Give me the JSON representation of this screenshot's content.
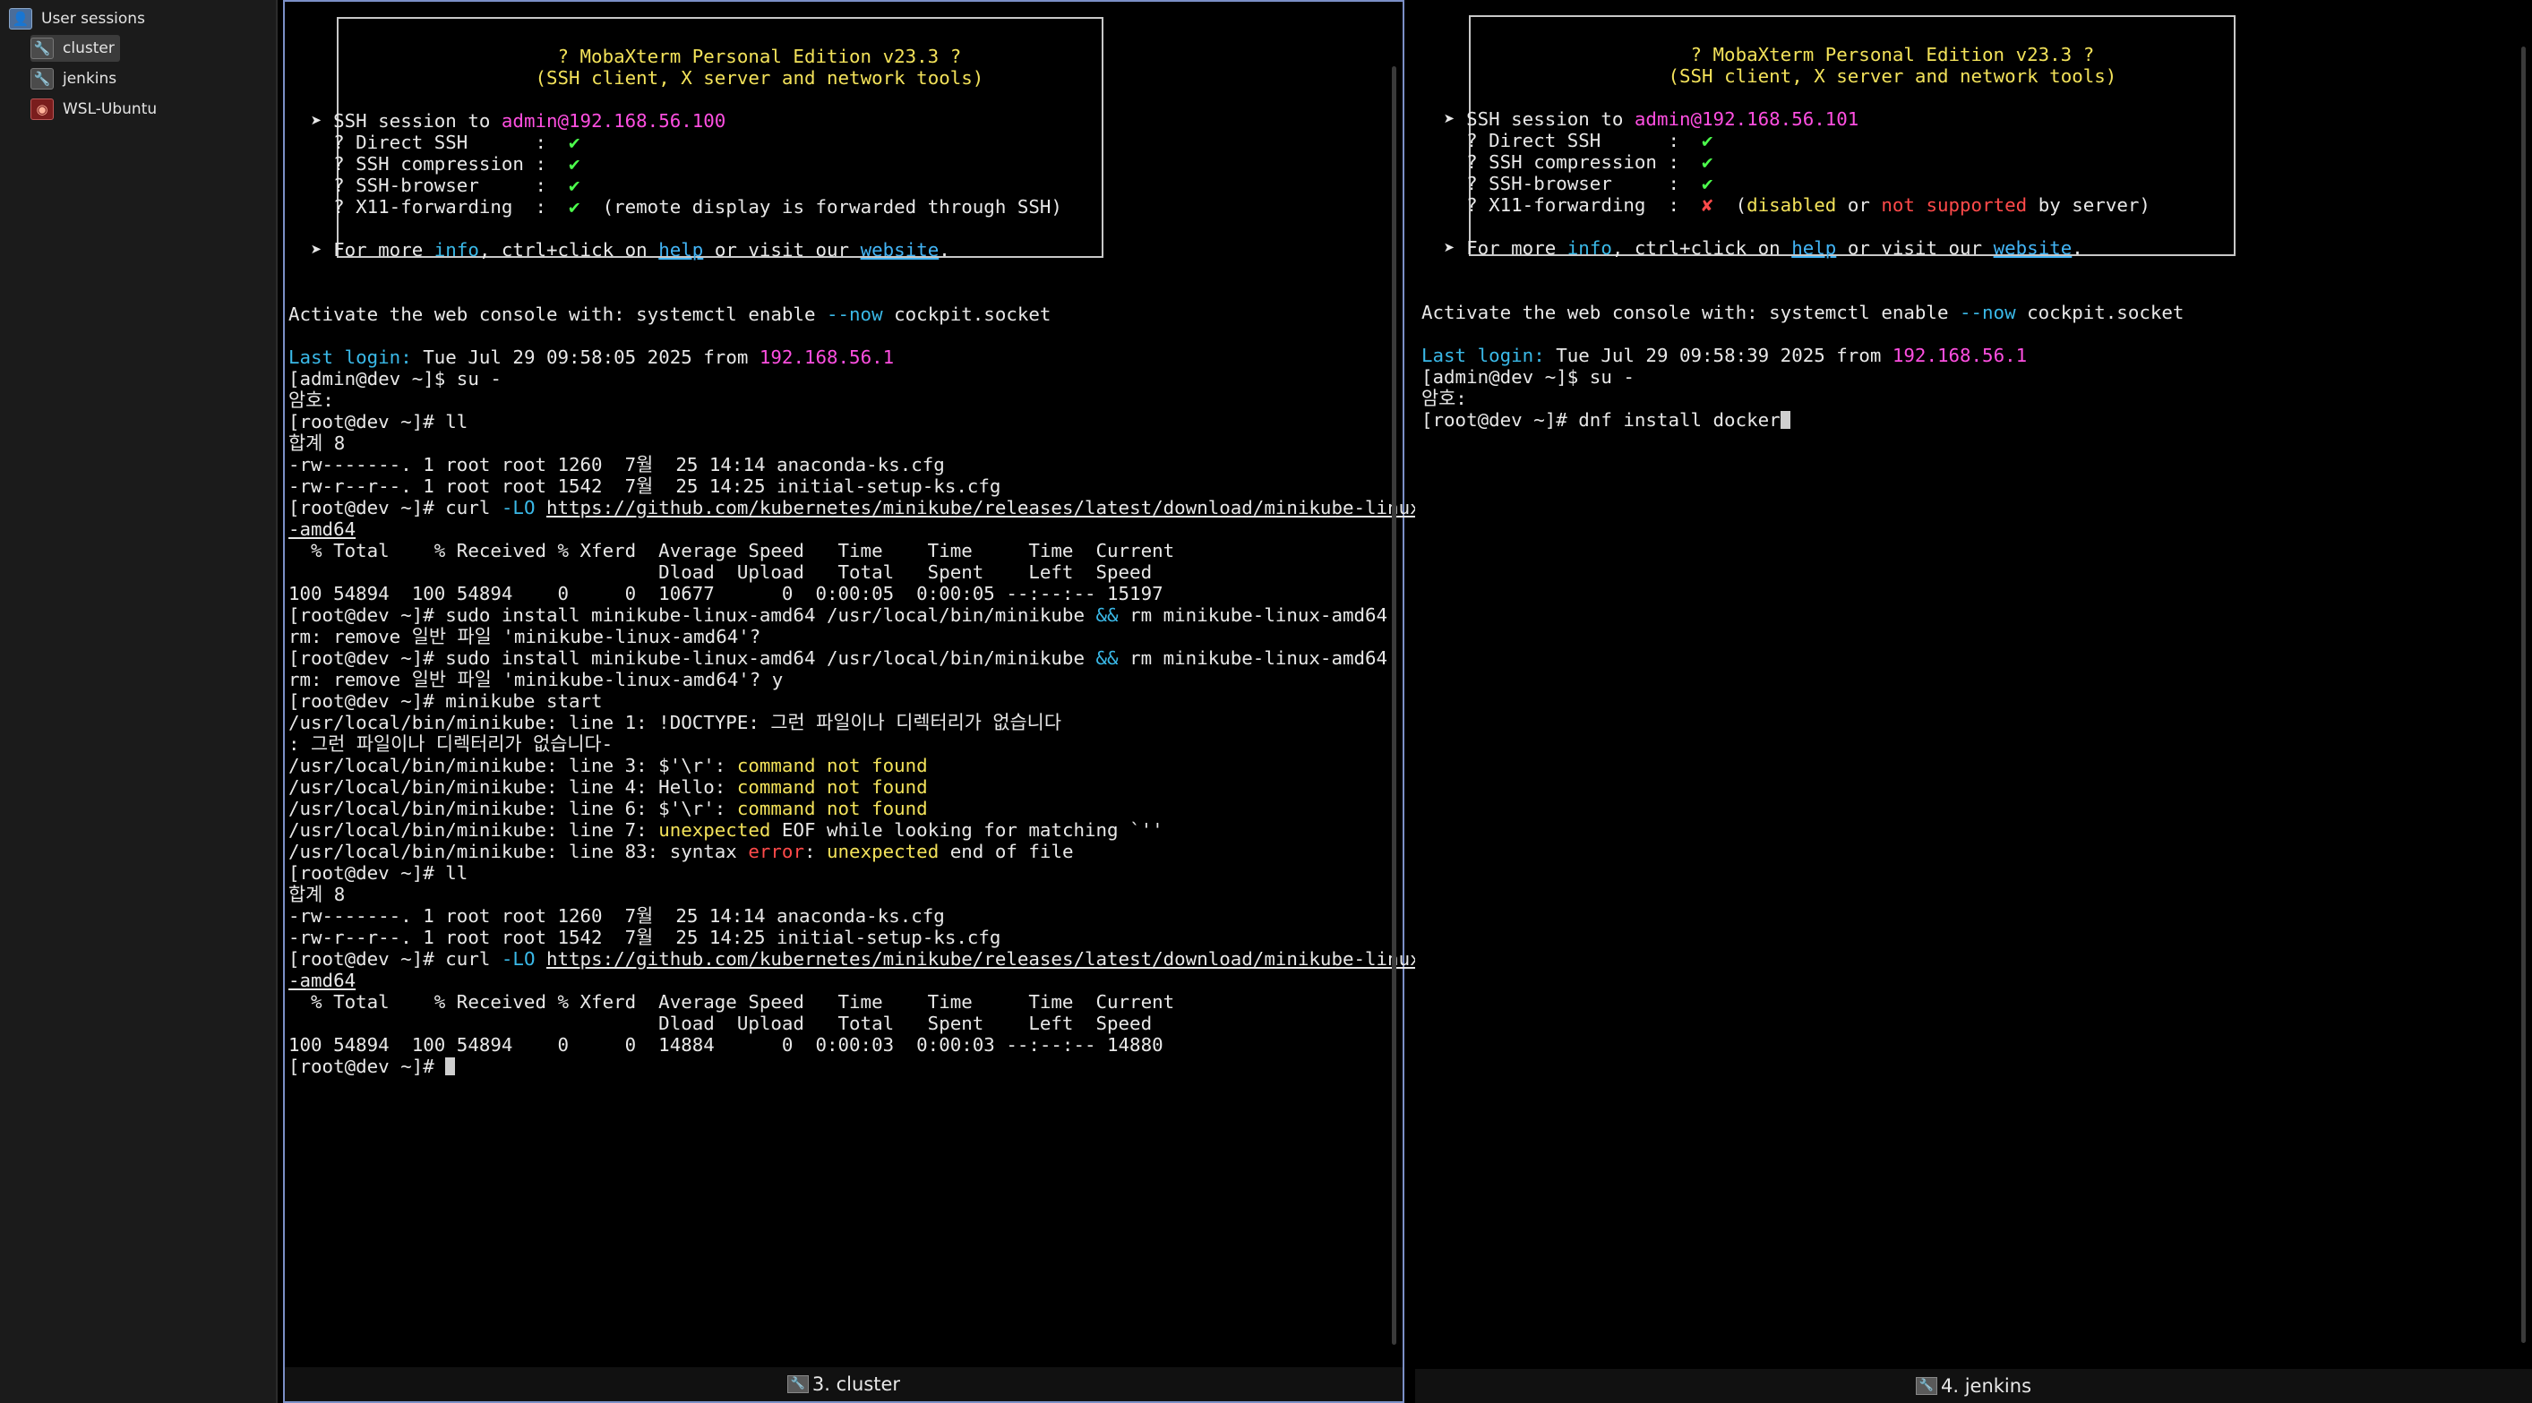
{
  "sidebar": {
    "header_label": "User sessions",
    "items": [
      {
        "label": "cluster",
        "icon": "wrench-icon",
        "active": true
      },
      {
        "label": "jenkins",
        "icon": "wrench-icon",
        "active": false
      },
      {
        "label": "WSL-Ubuntu",
        "icon": "ubuntu-icon",
        "active": false
      }
    ]
  },
  "banner": {
    "title": "? MobaXterm Personal Edition v23.3 ?",
    "subtitle": "(SSH client, X server and network tools)"
  },
  "tabs": {
    "left": "3. cluster",
    "right": "4. jenkins"
  },
  "colors": {
    "pane_border_active": "#7b8fc6",
    "green": "#3ce27a",
    "magenta": "#ff4fe1",
    "cyan": "#3ab9e8",
    "yellow": "#f3e25a",
    "red": "#ff4a4a"
  },
  "left_terminal": [
    [
      [
        "b",
        " "
      ]
    ],
    [
      [
        "t",
        "                        "
      ],
      [
        "y",
        "? MobaXterm Personal Edition v23.3 ?"
      ]
    ],
    [
      [
        "t",
        "                      "
      ],
      [
        "y",
        "(SSH client, X server and network tools)"
      ]
    ],
    [
      [
        "b",
        " "
      ]
    ],
    [
      [
        "t",
        "  ➤ SSH session to "
      ],
      [
        "m",
        "admin@192.168.56.100"
      ]
    ],
    [
      [
        "t",
        "    ? Direct SSH      :  "
      ],
      [
        "g",
        "✔"
      ]
    ],
    [
      [
        "t",
        "    ? SSH compression :  "
      ],
      [
        "g",
        "✔"
      ]
    ],
    [
      [
        "t",
        "    ? SSH-browser     :  "
      ],
      [
        "g",
        "✔"
      ]
    ],
    [
      [
        "t",
        "    ? X11-forwarding  :  "
      ],
      [
        "g",
        "✔"
      ],
      [
        "t",
        "  (remote display is forwarded through SSH)"
      ]
    ],
    [
      [
        "b",
        " "
      ]
    ],
    [
      [
        "t",
        "  ➤ For more "
      ],
      [
        "c",
        "info"
      ],
      [
        "t",
        ", ctrl+click on "
      ],
      [
        "l",
        "help"
      ],
      [
        "t",
        " or visit our "
      ],
      [
        "l",
        "website"
      ],
      [
        "t",
        "."
      ]
    ],
    [
      [
        "b",
        " "
      ]
    ],
    [
      [
        "b",
        " "
      ]
    ],
    [
      [
        "t",
        "Activate the web console with: systemctl enable "
      ],
      [
        "c",
        "--now"
      ],
      [
        "t",
        " cockpit.socket"
      ]
    ],
    [
      [
        "b",
        " "
      ]
    ],
    [
      [
        "c",
        "Last login:"
      ],
      [
        "t",
        " Tue Jul 29 09:58:05 2025 from "
      ],
      [
        "m",
        "192.168.56.1"
      ]
    ],
    [
      [
        "t",
        "[admin@dev ~]$ su -"
      ]
    ],
    [
      [
        "t",
        "암호:"
      ]
    ],
    [
      [
        "t",
        "[root@dev ~]# ll"
      ]
    ],
    [
      [
        "t",
        "합계 8"
      ]
    ],
    [
      [
        "t",
        "-rw-------. 1 root root 1260  7월  25 14:14 anaconda-ks.cfg"
      ]
    ],
    [
      [
        "t",
        "-rw-r--r--. 1 root root 1542  7월  25 14:25 initial-setup-ks.cfg"
      ]
    ],
    [
      [
        "t",
        "[root@dev ~]# curl "
      ],
      [
        "c",
        "-LO"
      ],
      [
        "t",
        " "
      ],
      [
        "u",
        "https://github.com/kubernetes/minikube/releases/latest/download/minikube-linux"
      ]
    ],
    [
      [
        "u",
        "-amd64"
      ]
    ],
    [
      [
        "t",
        "  % Total    % Received % Xferd  Average Speed   Time    Time     Time  Current"
      ]
    ],
    [
      [
        "t",
        "                                 Dload  Upload   Total   Spent    Left  Speed"
      ]
    ],
    [
      [
        "t",
        "100 54894  100 54894    0     0  10677      0  0:00:05  0:00:05 --:--:-- 15197"
      ]
    ],
    [
      [
        "t",
        "[root@dev ~]# sudo install minikube-linux-amd64 /usr/local/bin/minikube "
      ],
      [
        "c",
        "&&"
      ],
      [
        "t",
        " rm minikube-linux-amd64"
      ]
    ],
    [
      [
        "t",
        "rm: remove 일반 파일 'minikube-linux-amd64'?"
      ]
    ],
    [
      [
        "t",
        "[root@dev ~]# sudo install minikube-linux-amd64 /usr/local/bin/minikube "
      ],
      [
        "c",
        "&&"
      ],
      [
        "t",
        " rm minikube-linux-amd64"
      ]
    ],
    [
      [
        "t",
        "rm: remove 일반 파일 'minikube-linux-amd64'? y"
      ]
    ],
    [
      [
        "t",
        "[root@dev ~]# minikube start"
      ]
    ],
    [
      [
        "t",
        "/usr/local/bin/minikube: line 1: !DOCTYPE: 그런 파일이나 디렉터리가 없습니다"
      ]
    ],
    [
      [
        "t",
        ": 그런 파일이나 디렉터리가 없습니다-"
      ]
    ],
    [
      [
        "t",
        "/usr/local/bin/minikube: line 3: $'\\r': "
      ],
      [
        "y",
        "command not found"
      ]
    ],
    [
      [
        "t",
        "/usr/local/bin/minikube: line 4: Hello: "
      ],
      [
        "y",
        "command not found"
      ]
    ],
    [
      [
        "t",
        "/usr/local/bin/minikube: line 6: $'\\r': "
      ],
      [
        "y",
        "command not found"
      ]
    ],
    [
      [
        "t",
        "/usr/local/bin/minikube: line 7: "
      ],
      [
        "y",
        "unexpected"
      ],
      [
        "t",
        " EOF while looking for matching `''"
      ]
    ],
    [
      [
        "t",
        "/usr/local/bin/minikube: line 83: syntax "
      ],
      [
        "r",
        "error"
      ],
      [
        "t",
        ": "
      ],
      [
        "y",
        "unexpected"
      ],
      [
        "t",
        " end of file"
      ]
    ],
    [
      [
        "t",
        "[root@dev ~]# ll"
      ]
    ],
    [
      [
        "t",
        "합계 8"
      ]
    ],
    [
      [
        "t",
        "-rw-------. 1 root root 1260  7월  25 14:14 anaconda-ks.cfg"
      ]
    ],
    [
      [
        "t",
        "-rw-r--r--. 1 root root 1542  7월  25 14:25 initial-setup-ks.cfg"
      ]
    ],
    [
      [
        "t",
        "[root@dev ~]# curl "
      ],
      [
        "c",
        "-LO"
      ],
      [
        "t",
        " "
      ],
      [
        "u",
        "https://github.com/kubernetes/minikube/releases/latest/download/minikube-linux"
      ]
    ],
    [
      [
        "u",
        "-amd64"
      ]
    ],
    [
      [
        "t",
        "  % Total    % Received % Xferd  Average Speed   Time    Time     Time  Current"
      ]
    ],
    [
      [
        "t",
        "                                 Dload  Upload   Total   Spent    Left  Speed"
      ]
    ],
    [
      [
        "t",
        "100 54894  100 54894    0     0  14884      0  0:00:03  0:00:03 --:--:-- 14880"
      ]
    ],
    [
      [
        "t",
        "[root@dev ~]# "
      ],
      [
        "k",
        ""
      ]
    ]
  ],
  "right_terminal": [
    [
      [
        "b",
        " "
      ]
    ],
    [
      [
        "t",
        "                        "
      ],
      [
        "y",
        "? MobaXterm Personal Edition v23.3 ?"
      ]
    ],
    [
      [
        "t",
        "                      "
      ],
      [
        "y",
        "(SSH client, X server and network tools)"
      ]
    ],
    [
      [
        "b",
        " "
      ]
    ],
    [
      [
        "t",
        "  ➤ SSH session to "
      ],
      [
        "m",
        "admin@192.168.56.101"
      ]
    ],
    [
      [
        "t",
        "    ? Direct SSH      :  "
      ],
      [
        "g",
        "✔"
      ]
    ],
    [
      [
        "t",
        "    ? SSH compression :  "
      ],
      [
        "g",
        "✔"
      ]
    ],
    [
      [
        "t",
        "    ? SSH-browser     :  "
      ],
      [
        "g",
        "✔"
      ]
    ],
    [
      [
        "t",
        "    ? X11-forwarding  :  "
      ],
      [
        "r",
        "✘"
      ],
      [
        "t",
        "  ("
      ],
      [
        "y",
        "disabled"
      ],
      [
        "t",
        " or "
      ],
      [
        "r",
        "not supported"
      ],
      [
        "t",
        " by server)"
      ]
    ],
    [
      [
        "b",
        " "
      ]
    ],
    [
      [
        "t",
        "  ➤ For more "
      ],
      [
        "c",
        "info"
      ],
      [
        "t",
        ", ctrl+click on "
      ],
      [
        "l",
        "help"
      ],
      [
        "t",
        " or visit our "
      ],
      [
        "l",
        "website"
      ],
      [
        "t",
        "."
      ]
    ],
    [
      [
        "b",
        " "
      ]
    ],
    [
      [
        "b",
        " "
      ]
    ],
    [
      [
        "t",
        "Activate the web console with: systemctl enable "
      ],
      [
        "c",
        "--now"
      ],
      [
        "t",
        " cockpit.socket"
      ]
    ],
    [
      [
        "b",
        " "
      ]
    ],
    [
      [
        "c",
        "Last login:"
      ],
      [
        "t",
        " Tue Jul 29 09:58:39 2025 from "
      ],
      [
        "m",
        "192.168.56.1"
      ]
    ],
    [
      [
        "t",
        "[admin@dev ~]$ su -"
      ]
    ],
    [
      [
        "t",
        "암호:"
      ]
    ],
    [
      [
        "t",
        "[root@dev ~]# dnf install docker"
      ],
      [
        "k",
        ""
      ]
    ]
  ]
}
